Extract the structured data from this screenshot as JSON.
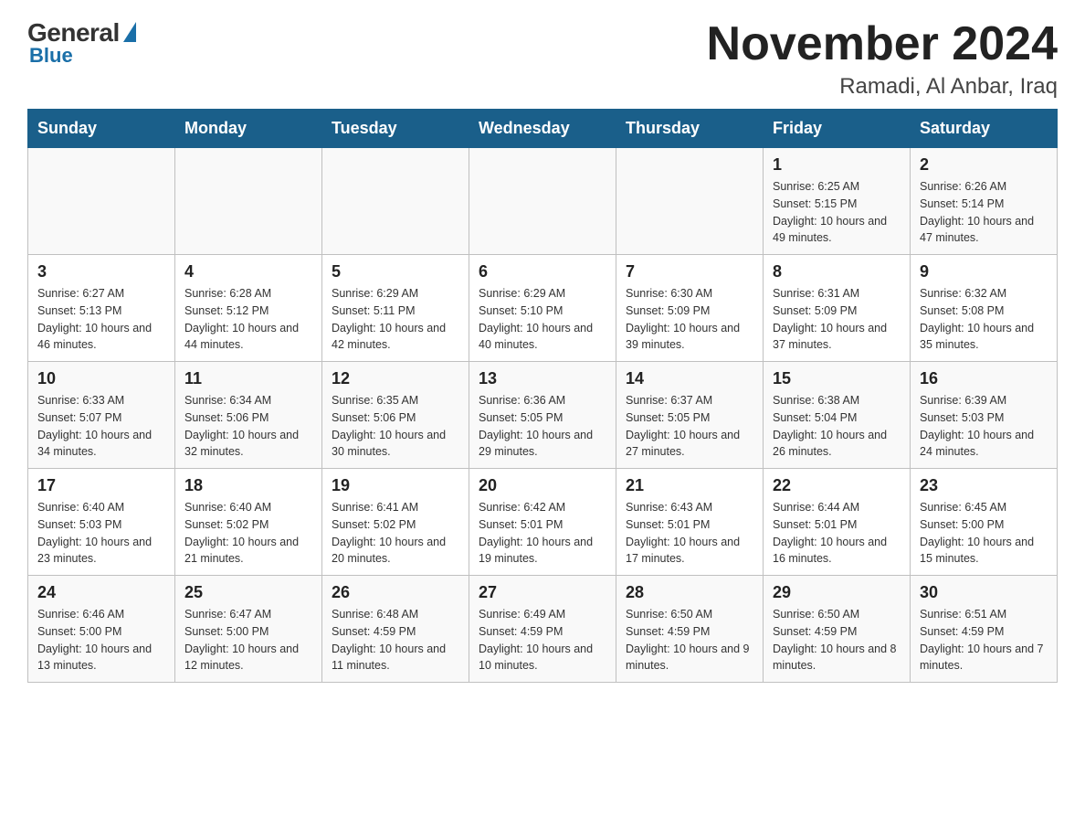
{
  "logo": {
    "general": "General",
    "blue": "Blue"
  },
  "title": "November 2024",
  "subtitle": "Ramadi, Al Anbar, Iraq",
  "days_of_week": [
    "Sunday",
    "Monday",
    "Tuesday",
    "Wednesday",
    "Thursday",
    "Friday",
    "Saturday"
  ],
  "weeks": [
    [
      {
        "day": "",
        "info": ""
      },
      {
        "day": "",
        "info": ""
      },
      {
        "day": "",
        "info": ""
      },
      {
        "day": "",
        "info": ""
      },
      {
        "day": "",
        "info": ""
      },
      {
        "day": "1",
        "info": "Sunrise: 6:25 AM\nSunset: 5:15 PM\nDaylight: 10 hours and 49 minutes."
      },
      {
        "day": "2",
        "info": "Sunrise: 6:26 AM\nSunset: 5:14 PM\nDaylight: 10 hours and 47 minutes."
      }
    ],
    [
      {
        "day": "3",
        "info": "Sunrise: 6:27 AM\nSunset: 5:13 PM\nDaylight: 10 hours and 46 minutes."
      },
      {
        "day": "4",
        "info": "Sunrise: 6:28 AM\nSunset: 5:12 PM\nDaylight: 10 hours and 44 minutes."
      },
      {
        "day": "5",
        "info": "Sunrise: 6:29 AM\nSunset: 5:11 PM\nDaylight: 10 hours and 42 minutes."
      },
      {
        "day": "6",
        "info": "Sunrise: 6:29 AM\nSunset: 5:10 PM\nDaylight: 10 hours and 40 minutes."
      },
      {
        "day": "7",
        "info": "Sunrise: 6:30 AM\nSunset: 5:09 PM\nDaylight: 10 hours and 39 minutes."
      },
      {
        "day": "8",
        "info": "Sunrise: 6:31 AM\nSunset: 5:09 PM\nDaylight: 10 hours and 37 minutes."
      },
      {
        "day": "9",
        "info": "Sunrise: 6:32 AM\nSunset: 5:08 PM\nDaylight: 10 hours and 35 minutes."
      }
    ],
    [
      {
        "day": "10",
        "info": "Sunrise: 6:33 AM\nSunset: 5:07 PM\nDaylight: 10 hours and 34 minutes."
      },
      {
        "day": "11",
        "info": "Sunrise: 6:34 AM\nSunset: 5:06 PM\nDaylight: 10 hours and 32 minutes."
      },
      {
        "day": "12",
        "info": "Sunrise: 6:35 AM\nSunset: 5:06 PM\nDaylight: 10 hours and 30 minutes."
      },
      {
        "day": "13",
        "info": "Sunrise: 6:36 AM\nSunset: 5:05 PM\nDaylight: 10 hours and 29 minutes."
      },
      {
        "day": "14",
        "info": "Sunrise: 6:37 AM\nSunset: 5:05 PM\nDaylight: 10 hours and 27 minutes."
      },
      {
        "day": "15",
        "info": "Sunrise: 6:38 AM\nSunset: 5:04 PM\nDaylight: 10 hours and 26 minutes."
      },
      {
        "day": "16",
        "info": "Sunrise: 6:39 AM\nSunset: 5:03 PM\nDaylight: 10 hours and 24 minutes."
      }
    ],
    [
      {
        "day": "17",
        "info": "Sunrise: 6:40 AM\nSunset: 5:03 PM\nDaylight: 10 hours and 23 minutes."
      },
      {
        "day": "18",
        "info": "Sunrise: 6:40 AM\nSunset: 5:02 PM\nDaylight: 10 hours and 21 minutes."
      },
      {
        "day": "19",
        "info": "Sunrise: 6:41 AM\nSunset: 5:02 PM\nDaylight: 10 hours and 20 minutes."
      },
      {
        "day": "20",
        "info": "Sunrise: 6:42 AM\nSunset: 5:01 PM\nDaylight: 10 hours and 19 minutes."
      },
      {
        "day": "21",
        "info": "Sunrise: 6:43 AM\nSunset: 5:01 PM\nDaylight: 10 hours and 17 minutes."
      },
      {
        "day": "22",
        "info": "Sunrise: 6:44 AM\nSunset: 5:01 PM\nDaylight: 10 hours and 16 minutes."
      },
      {
        "day": "23",
        "info": "Sunrise: 6:45 AM\nSunset: 5:00 PM\nDaylight: 10 hours and 15 minutes."
      }
    ],
    [
      {
        "day": "24",
        "info": "Sunrise: 6:46 AM\nSunset: 5:00 PM\nDaylight: 10 hours and 13 minutes."
      },
      {
        "day": "25",
        "info": "Sunrise: 6:47 AM\nSunset: 5:00 PM\nDaylight: 10 hours and 12 minutes."
      },
      {
        "day": "26",
        "info": "Sunrise: 6:48 AM\nSunset: 4:59 PM\nDaylight: 10 hours and 11 minutes."
      },
      {
        "day": "27",
        "info": "Sunrise: 6:49 AM\nSunset: 4:59 PM\nDaylight: 10 hours and 10 minutes."
      },
      {
        "day": "28",
        "info": "Sunrise: 6:50 AM\nSunset: 4:59 PM\nDaylight: 10 hours and 9 minutes."
      },
      {
        "day": "29",
        "info": "Sunrise: 6:50 AM\nSunset: 4:59 PM\nDaylight: 10 hours and 8 minutes."
      },
      {
        "day": "30",
        "info": "Sunrise: 6:51 AM\nSunset: 4:59 PM\nDaylight: 10 hours and 7 minutes."
      }
    ]
  ]
}
